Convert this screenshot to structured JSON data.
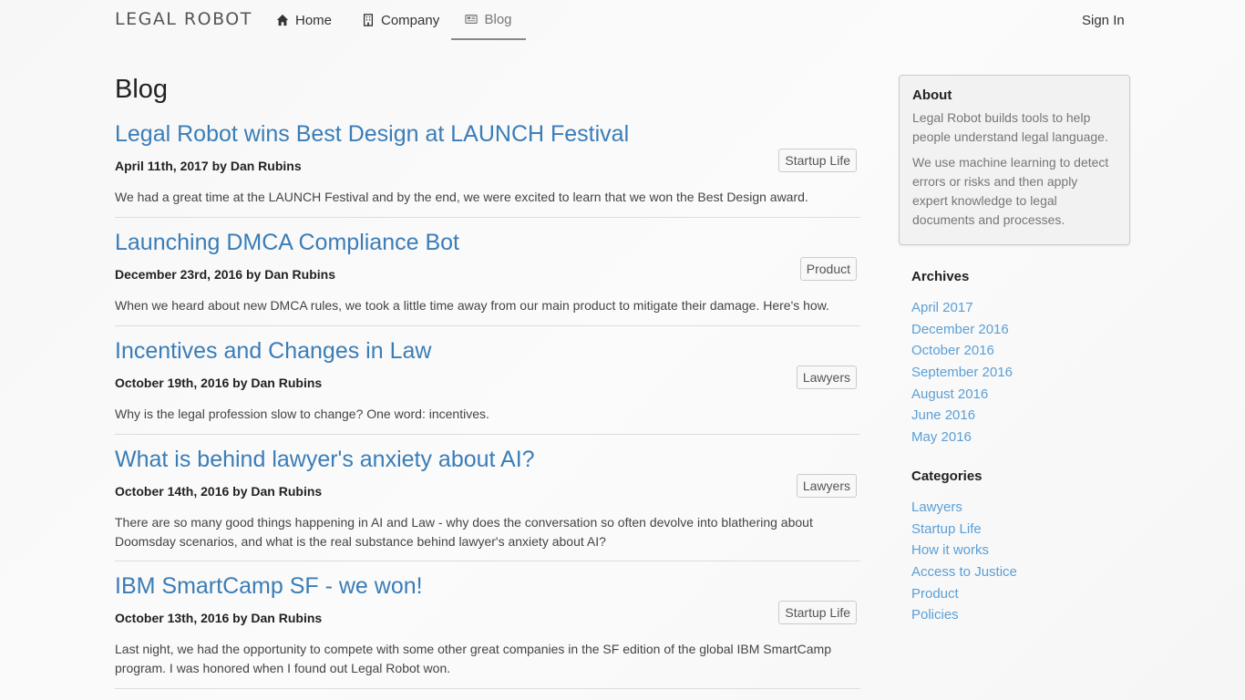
{
  "nav": {
    "logo": "LEGAL ROBOT",
    "home": "Home",
    "company": "Company",
    "blog": "Blog",
    "signin": "Sign In"
  },
  "page_title": "Blog",
  "posts": [
    {
      "title": "Legal Robot wins Best Design at LAUNCH Festival",
      "meta": "April 11th, 2017 by Dan Rubins",
      "tag": "Startup Life",
      "excerpt": "We had a great time at the LAUNCH Festival and by the end, we were excited to learn that we won the Best Design award."
    },
    {
      "title": "Launching DMCA Compliance Bot",
      "meta": "December 23rd, 2016 by Dan Rubins",
      "tag": "Product",
      "excerpt": "When we heard about new DMCA rules, we took a little time away from our main product to mitigate their damage. Here's how."
    },
    {
      "title": "Incentives and Changes in Law",
      "meta": "October 19th, 2016 by Dan Rubins",
      "tag": "Lawyers",
      "excerpt": "Why is the legal profession slow to change? One word: incentives."
    },
    {
      "title": "What is behind lawyer's anxiety about AI?",
      "meta": "October 14th, 2016 by Dan Rubins",
      "tag": "Lawyers",
      "excerpt": "There are so many good things happening in AI and Law - why does the conversation so often devolve into blathering about Doomsday scenarios, and what is the real substance behind lawyer's anxiety about AI?"
    },
    {
      "title": "IBM SmartCamp SF - we won!",
      "meta": "October 13th, 2016 by Dan Rubins",
      "tag": "Startup Life",
      "excerpt": "Last night, we had the opportunity to compete with some other great companies in the SF edition of the global IBM SmartCamp program. I was honored when I found out Legal Robot won."
    }
  ],
  "about": {
    "title": "About",
    "p1": "Legal Robot builds tools to help people understand legal language.",
    "p2": "We use machine learning to detect errors or risks and then apply expert knowledge to legal documents and processes."
  },
  "archives": {
    "title": "Archives",
    "items": [
      "April 2017",
      "December 2016",
      "October 2016",
      "September 2016",
      "August 2016",
      "June 2016",
      "May 2016"
    ]
  },
  "categories": {
    "title": "Categories",
    "items": [
      "Lawyers",
      "Startup Life",
      "How it works",
      "Access to Justice",
      "Product",
      "Policies"
    ]
  },
  "colors": {
    "link": "#3a7db7",
    "sidebar_link": "#5b9fd6"
  }
}
